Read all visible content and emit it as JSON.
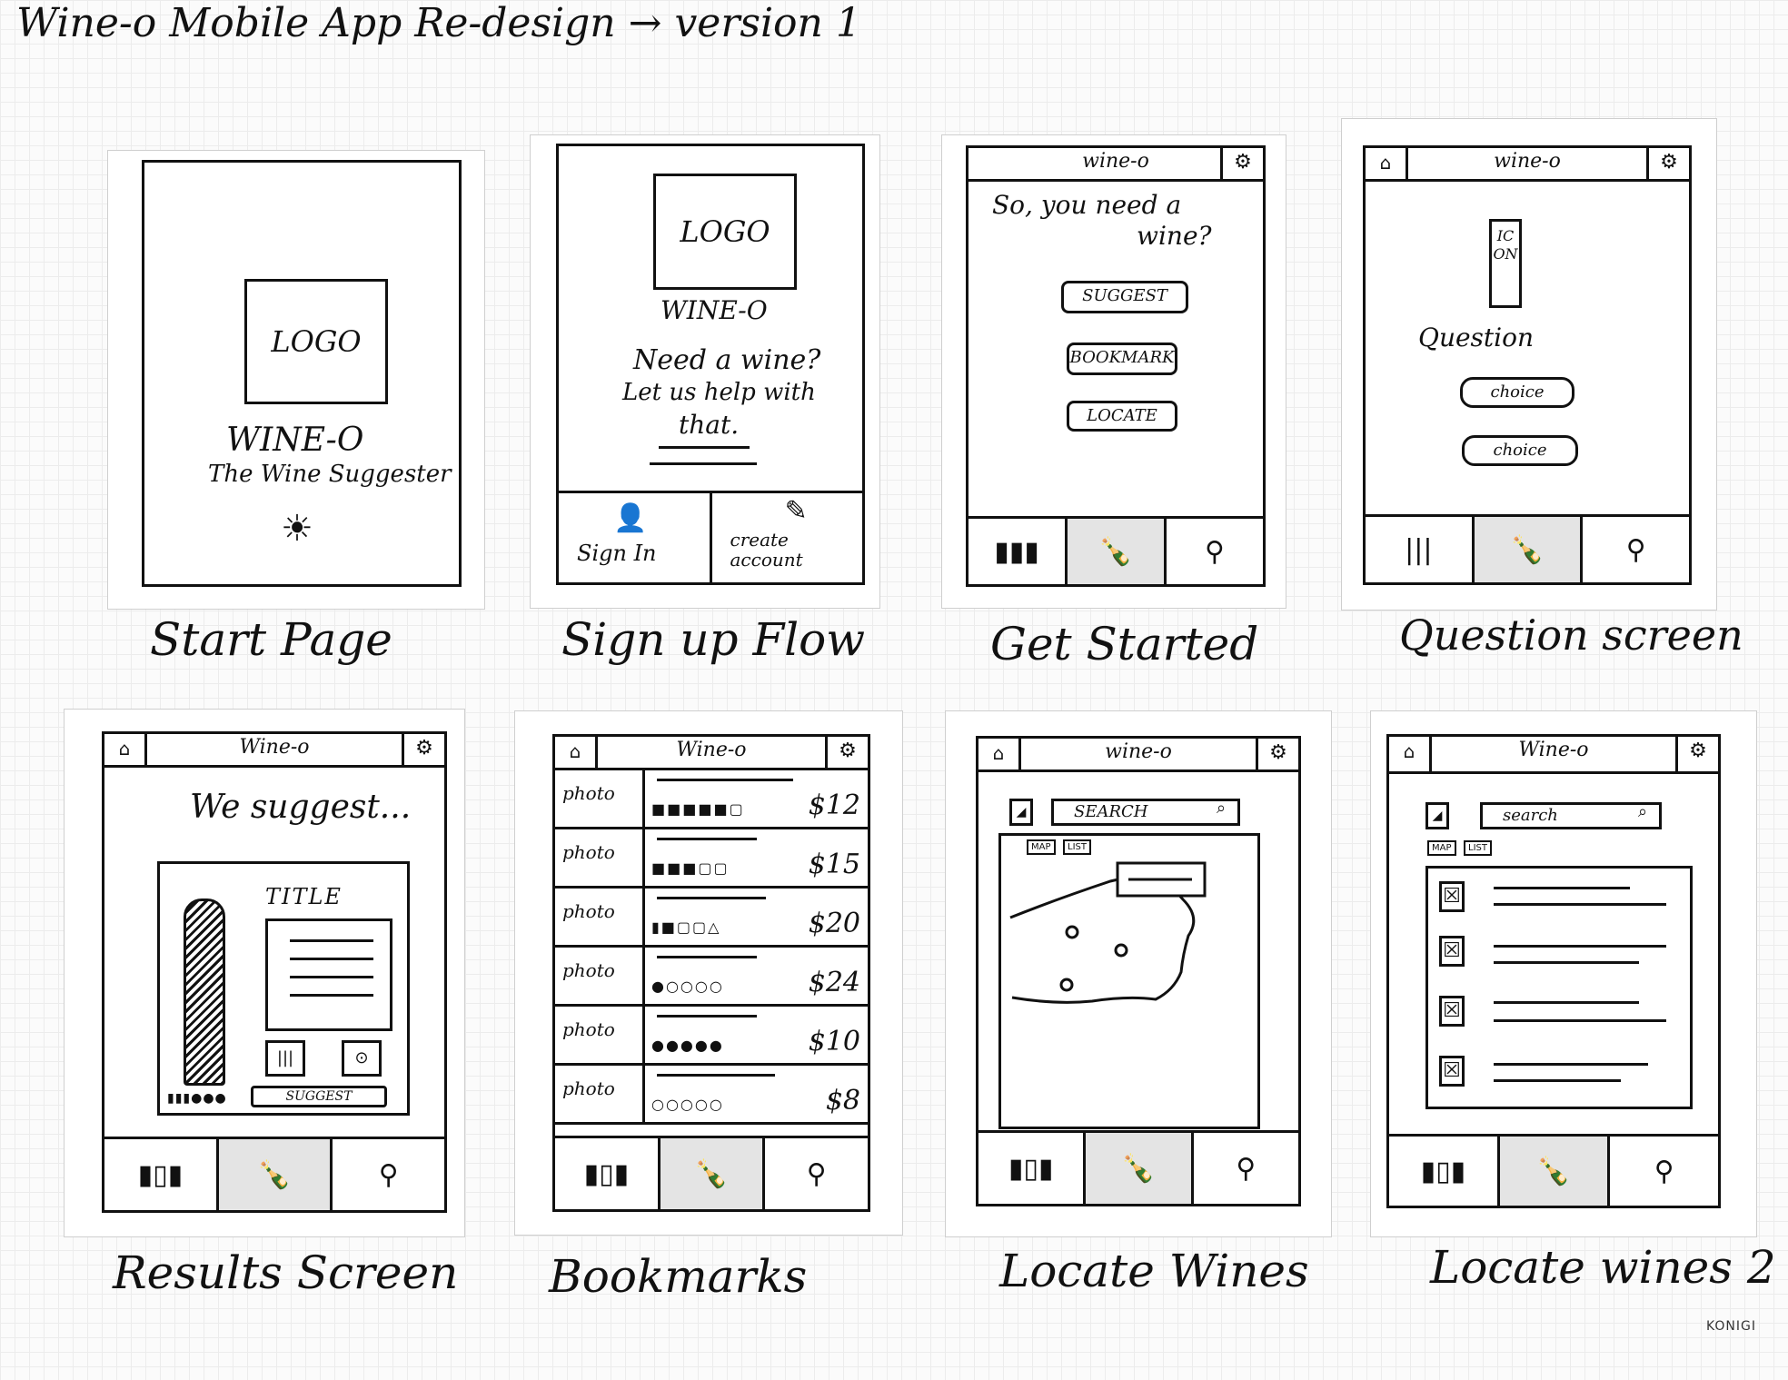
{
  "header": {
    "title": "Wine-o Mobile App Re-design → version 1"
  },
  "footer": {
    "credit": "KONIGI"
  },
  "screens": {
    "start": {
      "label": "Start Page",
      "logo": "LOGO",
      "brand": "WINE-O",
      "tagline": "The Wine Suggester"
    },
    "signup": {
      "label": "Sign up Flow",
      "logo": "LOGO",
      "brand": "WINE-O",
      "message_1": "Need a wine?",
      "message_2": "Let us help with",
      "message_3": "that.",
      "sign_in": "Sign In",
      "create_account": "create account"
    },
    "get_started": {
      "label": "Get Started",
      "app_title": "wine-o",
      "prompt_1": "So, you need a",
      "prompt_2": "wine?",
      "buttons": [
        "SUGGEST",
        "BOOKMARK",
        "LOCATE"
      ]
    },
    "question": {
      "label": "Question screen",
      "app_title": "wine-o",
      "icon_text": "ICON",
      "question": "Question",
      "choices": [
        "choice",
        "choice"
      ]
    },
    "results": {
      "label": "Results Screen",
      "app_title": "Wine-o",
      "headline": "We suggest...",
      "card_title": "TITLE",
      "suggest_button": "SUGGEST"
    },
    "bookmarks": {
      "label": "Bookmarks",
      "app_title": "Wine-o",
      "rows": [
        {
          "photo": "photo",
          "price": "$12"
        },
        {
          "photo": "photo",
          "price": "$15"
        },
        {
          "photo": "photo",
          "price": "$20"
        },
        {
          "photo": "photo",
          "price": "$24"
        },
        {
          "photo": "photo",
          "price": "$10"
        },
        {
          "photo": "photo",
          "price": "$8"
        }
      ]
    },
    "locate": {
      "label": "Locate Wines",
      "app_title": "wine-o",
      "search": "SEARCH",
      "map_tab": "MAP",
      "list_tab": "LIST"
    },
    "locate2": {
      "label": "Locate wines 2",
      "app_title": "Wine-o",
      "search": "search",
      "map_tab": "MAP",
      "list_tab": "LIST"
    }
  }
}
